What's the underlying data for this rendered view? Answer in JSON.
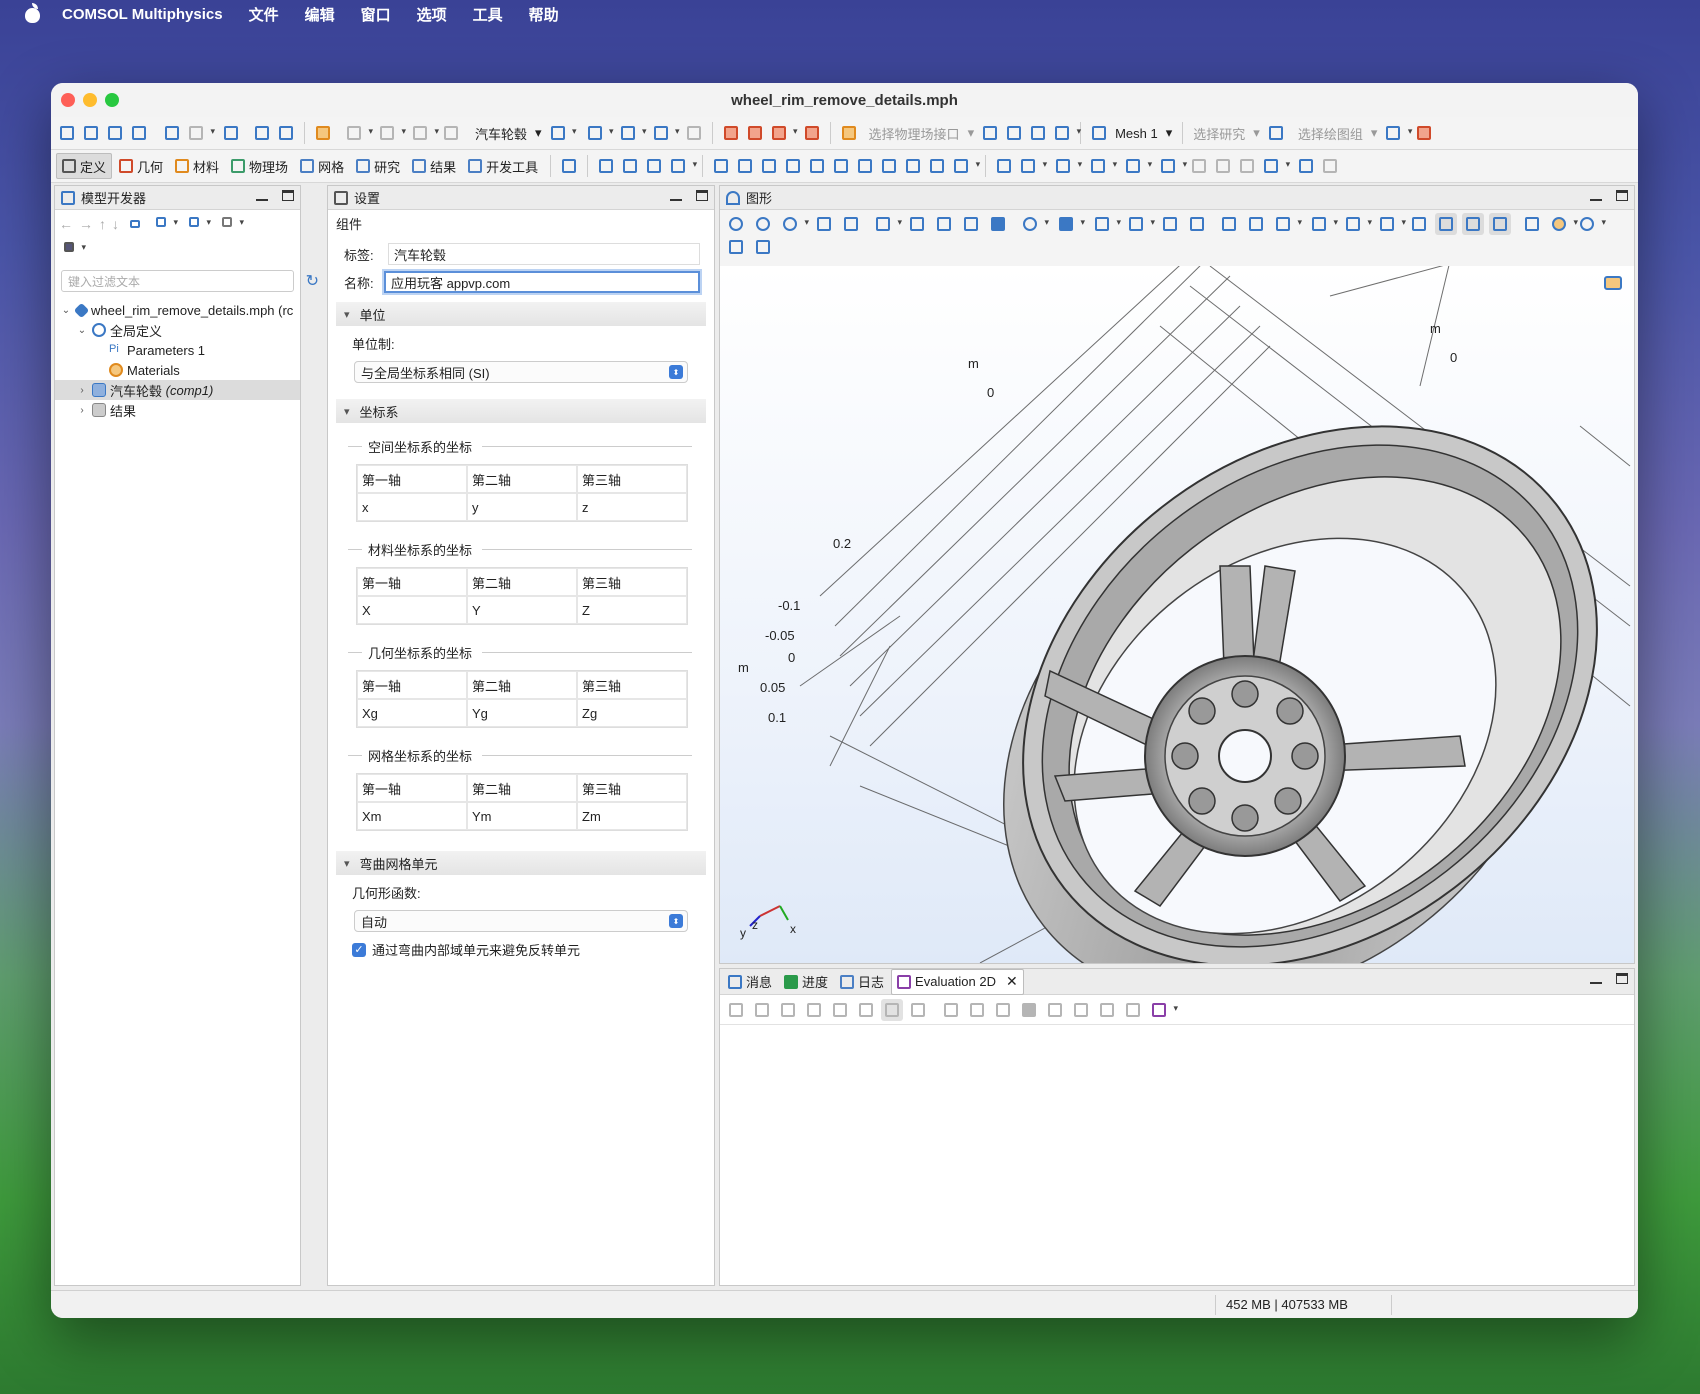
{
  "menubar": {
    "app": "COMSOL Multiphysics",
    "items": [
      "文件",
      "编辑",
      "窗口",
      "选项",
      "工具",
      "帮助"
    ]
  },
  "window": {
    "title": "wheel_rim_remove_details.mph"
  },
  "toolbar1": {
    "component": "汽车轮毂",
    "physics_interface": "选择物理场接口",
    "mesh": "Mesh 1",
    "study": "选择研究",
    "plot_group": "选择绘图组"
  },
  "ribbon_tabs": [
    "定义",
    "几何",
    "材料",
    "物理场",
    "网格",
    "研究",
    "结果",
    "开发工具"
  ],
  "model_builder": {
    "title": "模型开发器",
    "filter_placeholder": "键入过滤文本",
    "tree": [
      "wheel_rim_remove_details.mph (rc",
      "全局定义",
      "Parameters 1",
      "Materials",
      "汽车轮毂",
      "(comp1)",
      "结果"
    ]
  },
  "settings": {
    "title": "设置",
    "subtitle": "组件",
    "label_caption": "标签:",
    "label_value": "汽车轮毂",
    "name_caption": "名称:",
    "name_value": "应用玩客 appvp.com",
    "units_section": "单位",
    "unit_system_caption": "单位制:",
    "unit_system_value": "与全局坐标系相同 (SI)",
    "coords_section": "坐标系",
    "coord_groups": [
      {
        "title": "空间坐标系的坐标",
        "headers": [
          "第一轴",
          "第二轴",
          "第三轴"
        ],
        "values": [
          "x",
          "y",
          "z"
        ]
      },
      {
        "title": "材料坐标系的坐标",
        "headers": [
          "第一轴",
          "第二轴",
          "第三轴"
        ],
        "values": [
          "X",
          "Y",
          "Z"
        ]
      },
      {
        "title": "几何坐标系的坐标",
        "headers": [
          "第一轴",
          "第二轴",
          "第三轴"
        ],
        "values": [
          "Xg",
          "Yg",
          "Zg"
        ]
      },
      {
        "title": "网格坐标系的坐标",
        "headers": [
          "第一轴",
          "第二轴",
          "第三轴"
        ],
        "values": [
          "Xm",
          "Ym",
          "Zm"
        ]
      }
    ],
    "curved_section": "弯曲网格单元",
    "geom_shape_caption": "几何形函数:",
    "geom_shape_value": "自动",
    "checkbox_label": "通过弯曲内部域单元来避免反转单元"
  },
  "graphics": {
    "title": "图形",
    "axis_labels": [
      "m",
      "0",
      "m",
      "0",
      "0.2",
      "-0.1",
      "-0.05",
      "m",
      "0",
      "0.05",
      "0.1"
    ],
    "triad": [
      "y",
      "z",
      "x"
    ]
  },
  "bottom": {
    "tabs": [
      "消息",
      "进度",
      "日志",
      "Evaluation 2D"
    ]
  },
  "status": {
    "memory": "452 MB | 407533 MB"
  }
}
